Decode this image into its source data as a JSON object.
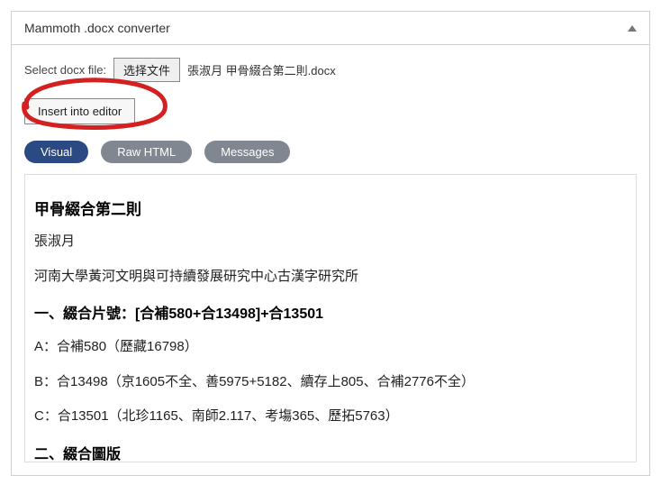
{
  "panel": {
    "title": "Mammoth .docx converter"
  },
  "file": {
    "label": "Select docx file:",
    "choose_label": "选择文件",
    "name": "張淑月 甲骨綴合第二則.docx"
  },
  "insert": {
    "label": "Insert into editor"
  },
  "tabs": {
    "visual": "Visual",
    "raw": "Raw HTML",
    "messages": "Messages"
  },
  "doc": {
    "title": "甲骨綴合第二則",
    "author": "張淑月",
    "affiliation": "河南大學黃河文明與可持續發展研究中心古漢字研究所",
    "section1": "一、綴合片號：[合補580+合13498]+合13501",
    "lineA": "A：合補580（歷藏16798）",
    "lineB": "B：合13498（京1605不全、善5975+5182、續存上805、合補2776不全）",
    "lineC": "C：合13501（北珍1165、南師2.117、考塲365、歷拓5763）",
    "section2": "二、綴合圖版"
  },
  "annotation": {
    "color": "#d42020"
  }
}
